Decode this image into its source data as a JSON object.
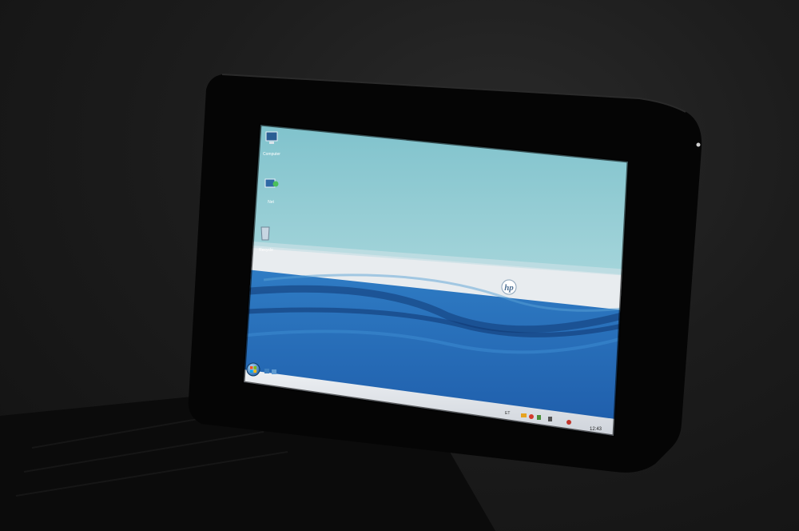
{
  "desktop": {
    "icons": [
      {
        "label": "Computer",
        "icon": "computer-icon"
      },
      {
        "label": "Net",
        "icon": "network-icon"
      },
      {
        "label": "Recycle",
        "icon": "recycle-bin-icon"
      }
    ]
  },
  "wallpaper": {
    "brand_logo_text": "hp",
    "colors": {
      "sky_top": "#7fc2cc",
      "sky_bottom": "#a9d7dc",
      "band": "#e8ecef",
      "water_top": "#2f7cc4",
      "water_bottom": "#1d5aa8"
    }
  },
  "taskbar": {
    "start_button_icon": "windows-start-orb-icon",
    "quick_launch_icons": [
      "show-desktop-icon",
      "switch-windows-icon"
    ],
    "language_indicator": "ET",
    "clock": "12:43",
    "tray_icons": [
      "battery-icon",
      "security-icon",
      "network-tray-icon",
      "volume-icon",
      "power-icon"
    ]
  },
  "device": {
    "bezel_color": "#050505",
    "body_color": "#0b0b0b"
  }
}
